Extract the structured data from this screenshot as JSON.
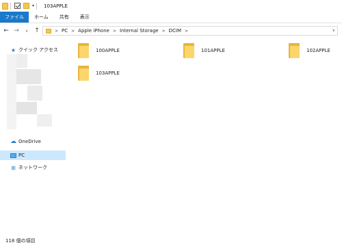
{
  "window": {
    "title": "103APPLE"
  },
  "ribbon": {
    "tabs": [
      "ファイル",
      "ホーム",
      "共有",
      "表示"
    ]
  },
  "address": {
    "crumbs": [
      "PC",
      "Apple iPhone",
      "Internal Storage",
      "DCIM"
    ]
  },
  "nav_pane": {
    "quick_access": "クイック アクセス",
    "onedrive": "OneDrive",
    "pc": "PC",
    "network": "ネットワーク"
  },
  "folders": [
    {
      "name": "100APPLE"
    },
    {
      "name": "101APPLE"
    },
    {
      "name": "102APPLE"
    },
    {
      "name": "103APPLE"
    }
  ],
  "status": {
    "item_count": "118 個の項目"
  },
  "colors": {
    "accent": "#1979ca",
    "selected": "#cce8ff",
    "folder": "#fcd66a"
  }
}
